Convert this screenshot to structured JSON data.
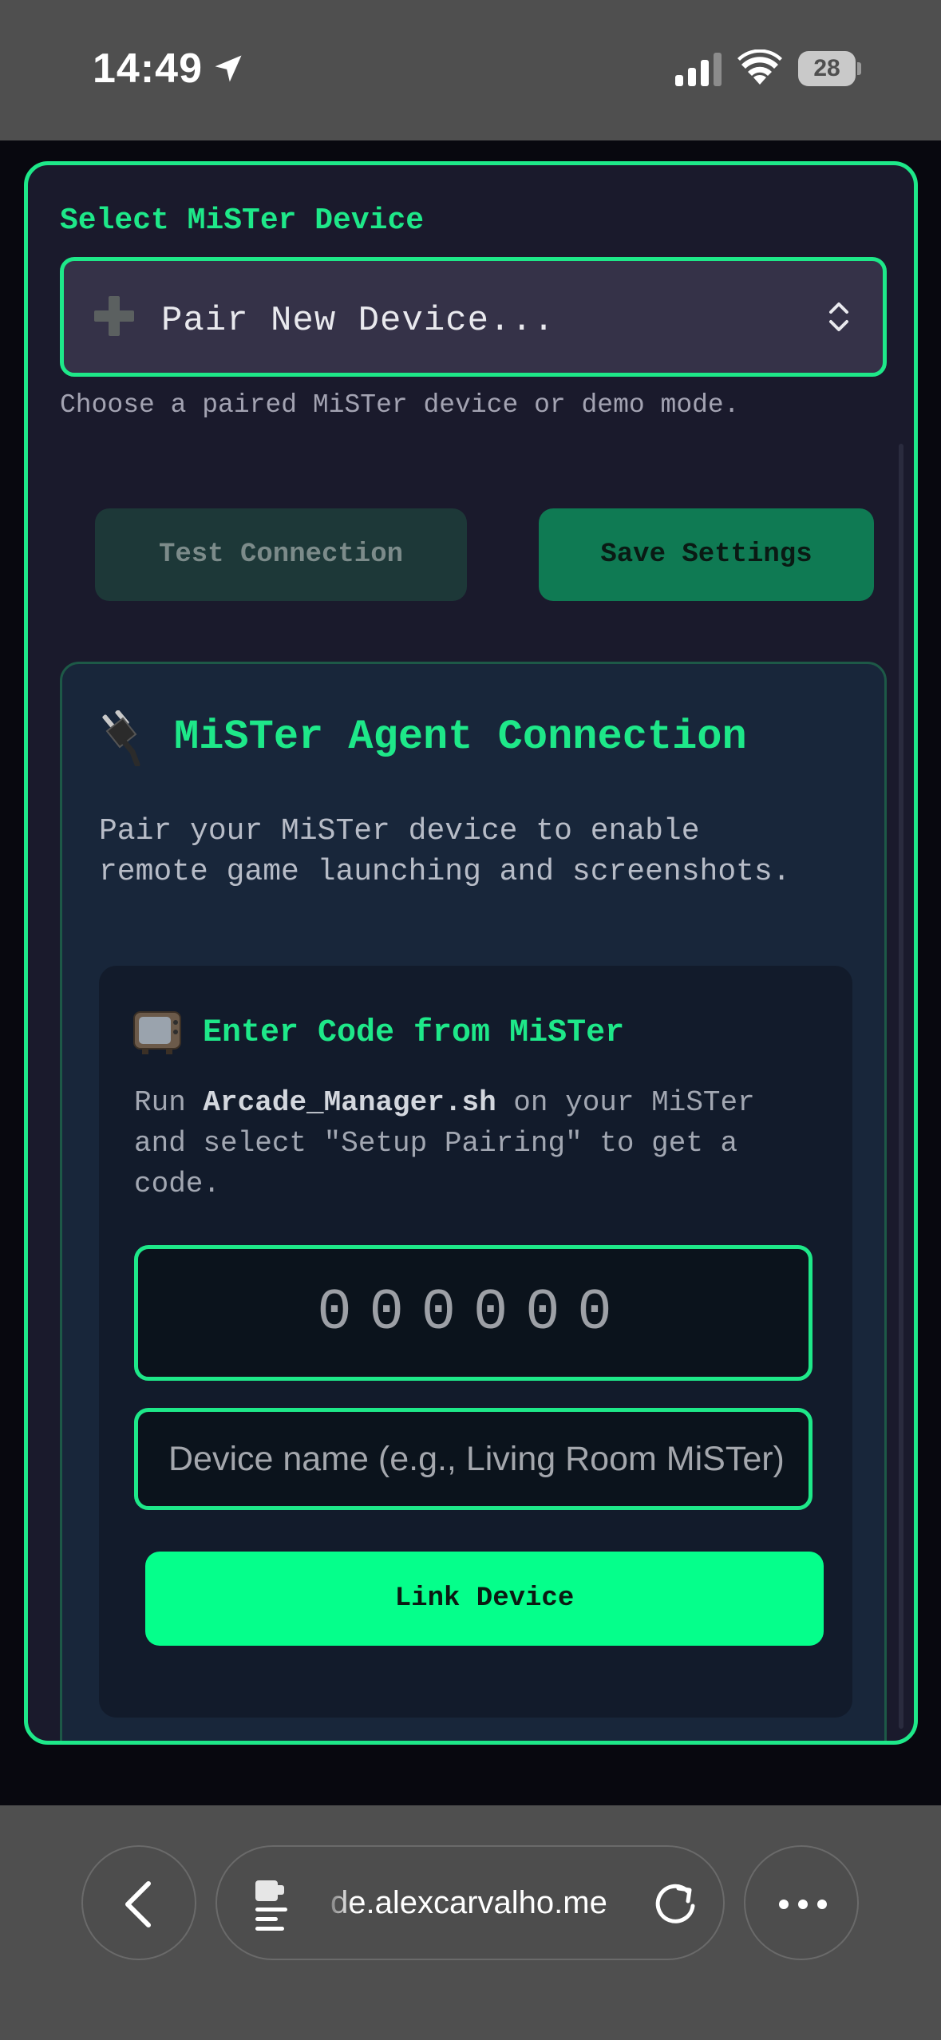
{
  "status_bar": {
    "time": "14:49",
    "battery_level": "28",
    "icons": [
      "location-arrow-icon",
      "cellular-signal-icon",
      "wifi-icon",
      "battery-icon"
    ]
  },
  "settings": {
    "select_label": "Select MiSTer Device",
    "selected_device": "Pair New Device...",
    "select_help": "Choose a paired MiSTer device or demo mode.",
    "test_connection_label": "Test Connection",
    "save_settings_label": "Save Settings"
  },
  "agent_card": {
    "title": "MiSTer Agent Connection",
    "description": "Pair your MiSTer device to enable remote game launching and screenshots.",
    "pairing": {
      "title": "Enter Code from MiSTer",
      "desc_prefix": "Run ",
      "script_name": "Arcade_Manager.sh",
      "desc_suffix": " on your MiSTer and select \"Setup Pairing\" to get a code.",
      "code_placeholder": "000000",
      "device_name_placeholder": "Device name (e.g., Living Room MiSTer)",
      "link_button_label": "Link Device"
    }
  },
  "browser": {
    "url_text": "de.alexcarvalho.me"
  },
  "colors": {
    "accent": "#1ee889",
    "link_button": "#05ff8b",
    "panel_bg": "#1a1a2c",
    "card_bg": "#18263a"
  }
}
